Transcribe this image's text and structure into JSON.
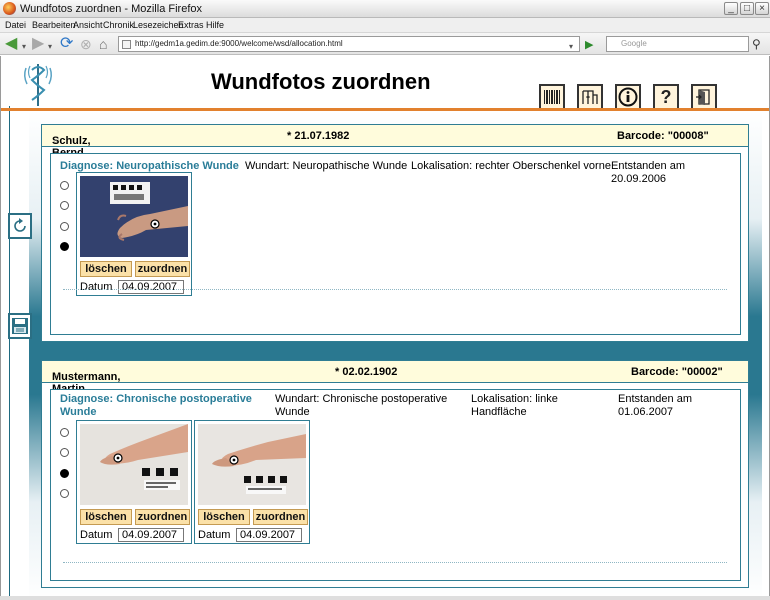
{
  "window": {
    "title": "Wundfotos zuordnen - Mozilla Firefox",
    "minimize": "_",
    "maximize": "□",
    "close": "×"
  },
  "menu": [
    "Datei",
    "Bearbeiten",
    "Ansicht",
    "Chronik",
    "Lesezeichen",
    "Extras",
    "Hilfe"
  ],
  "nav": {
    "url": "http://gedm1a.gedim.de:9000/welcome/wsd/allocation.html",
    "search_placeholder": "Google"
  },
  "page": {
    "title": "Wundfotos zuordnen",
    "toolbar_icons": [
      "barcode-icon",
      "wardrobe-icon",
      "info-icon",
      "help-icon",
      "exit-door-icon"
    ]
  },
  "patients": [
    {
      "name": "Schulz, Bernd",
      "sex": "♂",
      "dob": "* 21.07.1982",
      "barcode": "Barcode: \"00008\"",
      "diagnosis": "Diagnose: Neuropathische Wunde",
      "wundart": "Wundart: Neuropathische Wunde",
      "lokalisation": "Lokalisation: rechter Oberschenkel vorne",
      "entstanden": "Entstanden am 20.09.2006",
      "radios": [
        false,
        false,
        false,
        true
      ],
      "photos": [
        {
          "delete_label": "löschen",
          "assign_label": "zuordnen",
          "date_label": "Datum",
          "date": "04.09.2007"
        }
      ]
    },
    {
      "name": "Mustermann, Martin",
      "sex": "♂",
      "dob": "* 02.02.1902",
      "barcode": "Barcode: \"00002\"",
      "diagnosis_line1": "Diagnose: Chronische postoperative",
      "diagnosis_line2": "Wunde",
      "wundart_line1": "Wundart: Chronische postoperative",
      "wundart_line2": "Wunde",
      "lokalisation_line1": "Lokalisation: linke",
      "lokalisation_line2": "Handfläche",
      "entstanden_line1": "Entstanden am",
      "entstanden_line2": "01.06.2007",
      "radios": [
        false,
        false,
        true,
        false
      ],
      "photos": [
        {
          "delete_label": "löschen",
          "assign_label": "zuordnen",
          "date_label": "Datum",
          "date": "04.09.2007"
        },
        {
          "delete_label": "löschen",
          "assign_label": "zuordnen",
          "date_label": "Datum",
          "date": "04.09.2007"
        }
      ]
    }
  ]
}
